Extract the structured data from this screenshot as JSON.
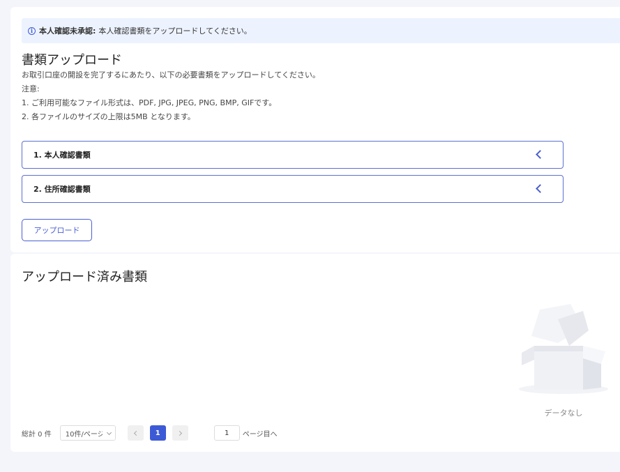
{
  "notice": {
    "strong": "本人確認未承認:",
    "text": "本人確認書類をアップロードしてください。"
  },
  "upload": {
    "title": "書類アップロード",
    "description": "お取引口座の開設を完了するにあたり、以下の必要書類をアップロードしてください。",
    "note_label": "注意:",
    "note_1": "1. ご利用可能なファイル形式は、PDF, JPG, JPEG, PNG, BMP, GIFです。",
    "note_2": "2. 各ファイルのサイズの上限は5MB となります。",
    "sections": [
      {
        "label": "1. 本人確認書類"
      },
      {
        "label": "2. 住所確認書類"
      }
    ],
    "button_label": "アップロード"
  },
  "uploaded": {
    "title": "アップロード済み書類",
    "empty_text": "データなし"
  },
  "pagination": {
    "total": "総計 0 件",
    "page_size": "10件/ページ",
    "current_page": "1",
    "jump_value": "1",
    "jump_label": "ページ目へ"
  },
  "colors": {
    "accent": "#3d5ad6",
    "notice_bg": "#edf3fe",
    "page_bg": "#f4f5fb"
  }
}
